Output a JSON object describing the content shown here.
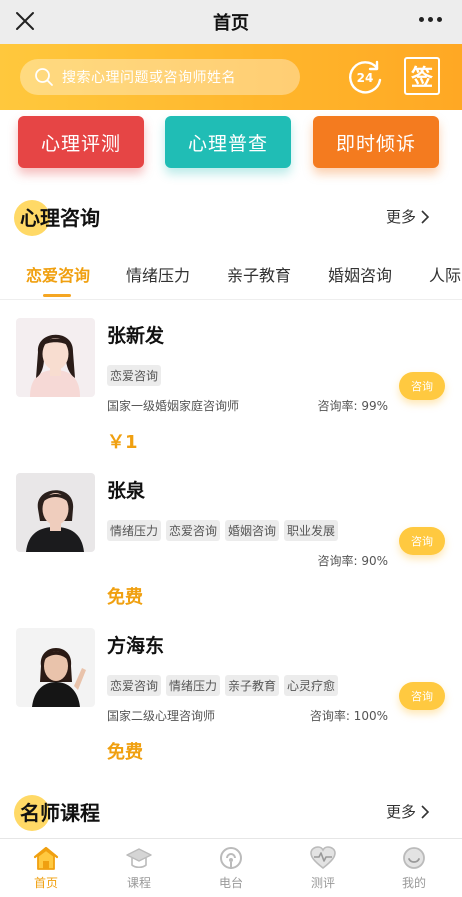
{
  "navbar": {
    "title": "首页"
  },
  "search": {
    "placeholder": "搜索心理问题或咨询师姓名"
  },
  "header_icons": {
    "sign_label": "签",
    "hours_label": "24"
  },
  "quick_actions": [
    {
      "label": "心理评测",
      "color": "#e64545"
    },
    {
      "label": "心理普查",
      "color": "#20bdb5"
    },
    {
      "label": "即时倾诉",
      "color": "#f47b1f"
    }
  ],
  "consult_section": {
    "title": "心理咨询",
    "more": "更多"
  },
  "tabs": [
    "恋爱咨询",
    "情绪压力",
    "亲子教育",
    "婚姻咨询",
    "人际"
  ],
  "active_tab": 0,
  "counselors": [
    {
      "name": "张新发",
      "tags": [
        "恋爱咨询"
      ],
      "title": "国家一级婚姻家庭咨询师",
      "rate": "咨询率: 99%",
      "price": "￥1",
      "button": "咨询"
    },
    {
      "name": "张泉",
      "tags": [
        "情绪压力",
        "恋爱咨询",
        "婚姻咨询",
        "职业发展"
      ],
      "title": "",
      "rate": "咨询率: 90%",
      "price": "免费",
      "button": "咨询"
    },
    {
      "name": "方海东",
      "tags": [
        "恋爱咨询",
        "情绪压力",
        "亲子教育",
        "心灵疗愈"
      ],
      "title": "国家二级心理咨询师",
      "rate": "咨询率: 100%",
      "price": "免费",
      "button": "咨询"
    }
  ],
  "course_section": {
    "title": "名师课程",
    "more": "更多"
  },
  "bottom_tabs": [
    {
      "label": "首页",
      "icon": "home-icon",
      "active": true
    },
    {
      "label": "课程",
      "icon": "graduation-cap-icon",
      "active": false
    },
    {
      "label": "电台",
      "icon": "radio-icon",
      "active": false
    },
    {
      "label": "测评",
      "icon": "heart-pulse-icon",
      "active": false
    },
    {
      "label": "我的",
      "icon": "smile-face-icon",
      "active": false
    }
  ],
  "colors": {
    "accent": "#f0a010",
    "header": "#ffb52b",
    "consult_button": "#ffc940"
  }
}
